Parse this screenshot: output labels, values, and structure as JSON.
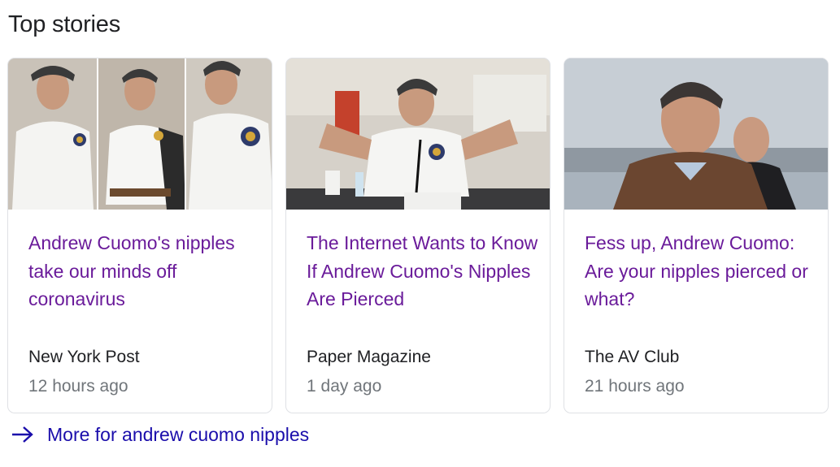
{
  "section": {
    "title": "Top stories"
  },
  "stories": [
    {
      "headline": "Andrew Cuomo's nipples take our minds off coronavirus",
      "source": "New York Post",
      "time": "12 hours ago",
      "image_icon": "photo-collage"
    },
    {
      "headline": "The Internet Wants to Know If Andrew Cuomo's Nipples Are Pierced",
      "source": "Paper Magazine",
      "time": "1 day ago",
      "image_icon": "photo-press-briefing"
    },
    {
      "headline": "Fess up, Andrew Cuomo: Are your nipples pierced or what?",
      "source": "The AV Club",
      "time": "21 hours ago",
      "image_icon": "photo-outdoor-portrait"
    }
  ],
  "more": {
    "label": "More for andrew cuomo nipples",
    "icon": "arrow-right-icon"
  },
  "colors": {
    "headline": "#6a1b9a",
    "link": "#1a0dab",
    "source_text": "#202124",
    "time_text": "#70757a",
    "card_border": "#dfe1e5"
  }
}
